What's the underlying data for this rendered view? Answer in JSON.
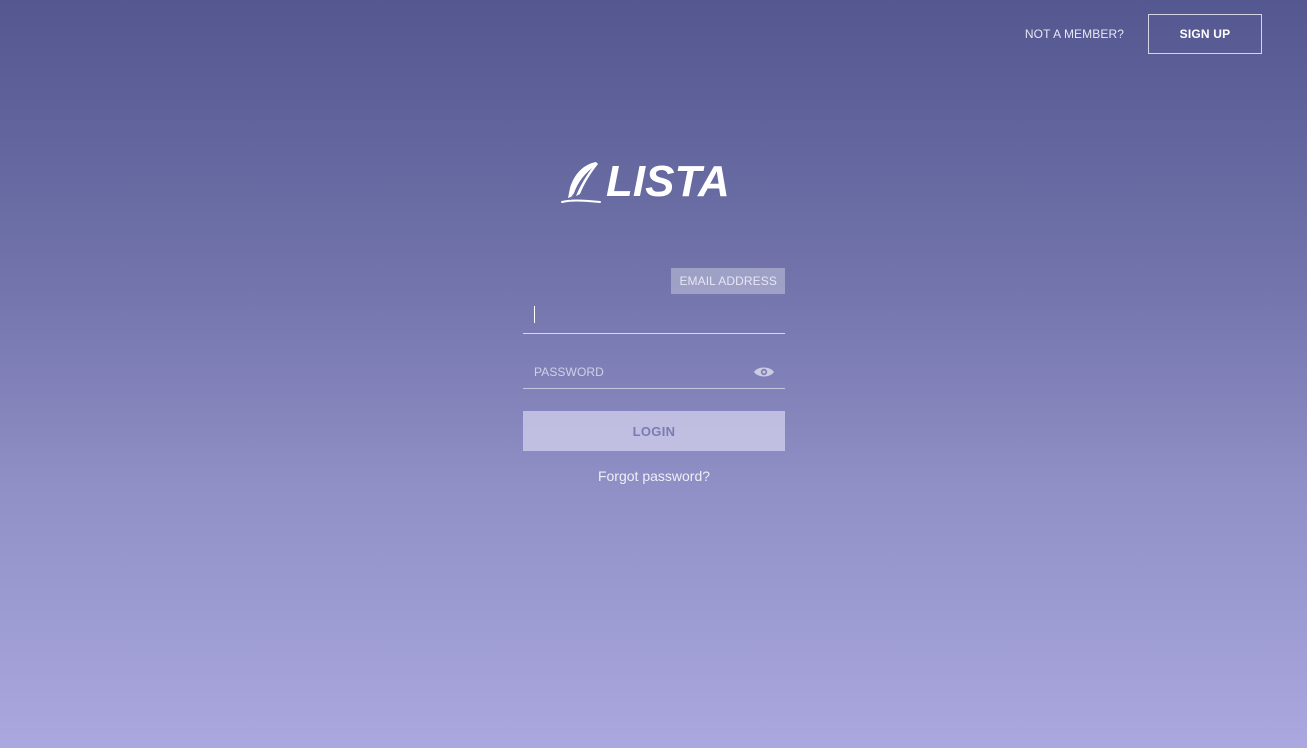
{
  "header": {
    "not_member_text": "NOT A MEMBER?",
    "signup_label": "SIGN UP"
  },
  "brand": {
    "logo_text": "LISTA",
    "logo_icon": "feather-icon"
  },
  "login_form": {
    "email_label": "EMAIL ADDRESS",
    "email_value": "",
    "password_placeholder": "PASSWORD",
    "password_toggle_icon": "eye-icon",
    "login_label": "LOGIN",
    "forgot_label": "Forgot password?"
  },
  "colors": {
    "gradient_top": "#545790",
    "gradient_bottom": "#aaa8de",
    "login_button_bg": "#d5d4ee",
    "login_button_text": "#7a7ab6"
  }
}
